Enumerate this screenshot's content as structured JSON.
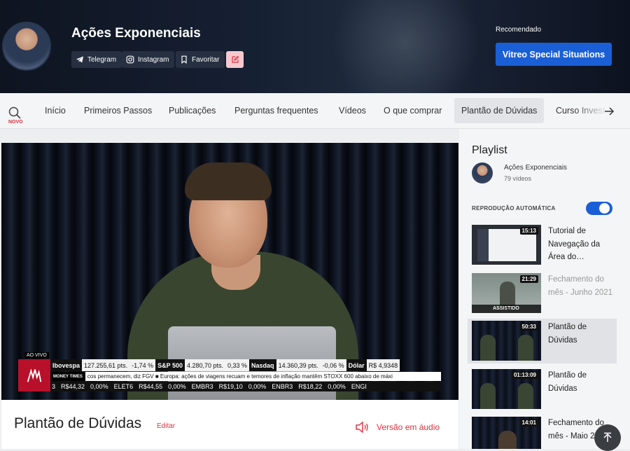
{
  "header": {
    "channel_title": "Ações Exponenciais",
    "social": [
      {
        "label": "Telegram",
        "icon": "telegram-icon"
      },
      {
        "label": "Instagram",
        "icon": "instagram-icon"
      },
      {
        "label": "Favoritar",
        "icon": "bookmark-icon"
      }
    ],
    "recommended_label": "Recomendado",
    "recommended_button": "Vitreo Special Situations"
  },
  "nav": {
    "search_badge": "NOVO",
    "items": [
      "Início",
      "Primeiros Passos",
      "Publicações",
      "Perguntas frequentes",
      "Vídeos",
      "O que comprar",
      "Plantão de Dúvidas",
      "Curso Invest"
    ],
    "active_index": 6
  },
  "player": {
    "live_badge": "AO VIVO",
    "ticker_row1": [
      "Ibovespa",
      "127.255,61 pts.",
      "-1,74 %",
      "S&P 500",
      "4.280,70 pts.",
      "0,33 %",
      "Nasdaq",
      "14.360,39 pts.",
      "-0,06 %",
      "Dólar",
      "R$ 4,9348"
    ],
    "ticker_row2_brand": "MONEY TIMES",
    "ticker_row2_text": "cos permanecem, diz FGV  ■  Europa: ações de viagens recuam e temores de inflação mantêm STOXX 600 abaixo de máxi",
    "ticker_row3": [
      "3",
      "R$44,32",
      "0,00%",
      "ELET6",
      "R$44,55",
      "0,00%",
      "EMBR3",
      "R$19,10",
      "0,00%",
      "ENBR3",
      "R$18,22",
      "0,00%",
      "ENGI"
    ]
  },
  "video_info": {
    "title": "Plantão de Dúvidas",
    "edit_label": "Editar",
    "audio_label": "Versão em áudio"
  },
  "playlist": {
    "title": "Playlist",
    "owner": "Ações Exponenciais",
    "count": "79 vídeos",
    "autoplay_label": "REPRODUÇÃO AUTOMÁTICA",
    "autoplay_on": true,
    "items": [
      {
        "title": "Tutorial de Navegação da Área do…",
        "duration": "15:13",
        "watched": false,
        "current": false
      },
      {
        "title": "Fechamento do mês - Junho 2021",
        "duration": "21:29",
        "watched": true,
        "watched_label": "ASSISTIDO",
        "current": false
      },
      {
        "title": "Plantão de Dúvidas",
        "duration": "50:33",
        "watched": false,
        "current": true
      },
      {
        "title": "Plantão de Dúvidas",
        "duration": "01:13:09",
        "watched": false,
        "current": false
      },
      {
        "title": "Fechamento do mês - Maio 2…",
        "duration": "14:01",
        "watched": false,
        "current": false
      }
    ]
  },
  "colors": {
    "accent_blue": "#1a5fd6",
    "accent_red": "#e0313d",
    "hero_bg": "#162033"
  }
}
